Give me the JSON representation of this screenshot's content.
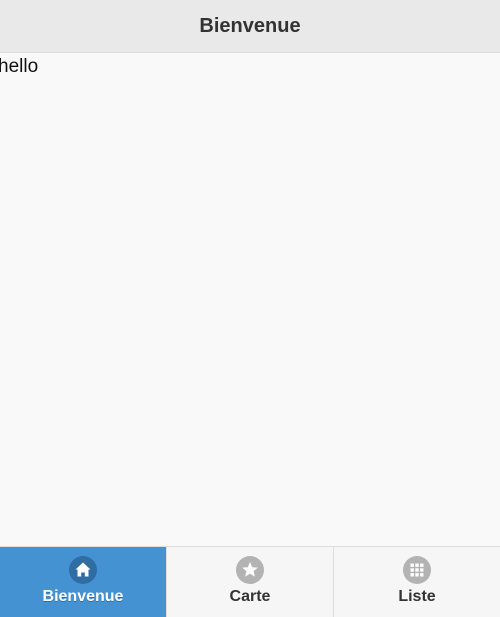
{
  "header": {
    "title": "Bienvenue"
  },
  "content": {
    "text": "hello"
  },
  "navbar": {
    "items": [
      {
        "label": "Bienvenue",
        "icon": "home-icon",
        "active": true
      },
      {
        "label": "Carte",
        "icon": "star-icon",
        "active": false
      },
      {
        "label": "Liste",
        "icon": "grid-icon",
        "active": false
      }
    ]
  },
  "colors": {
    "accent": "#4592d3",
    "header_bg": "#e9e9e9",
    "page_bg": "#f9f9f9",
    "icon_inactive": "#b3b3b3"
  }
}
